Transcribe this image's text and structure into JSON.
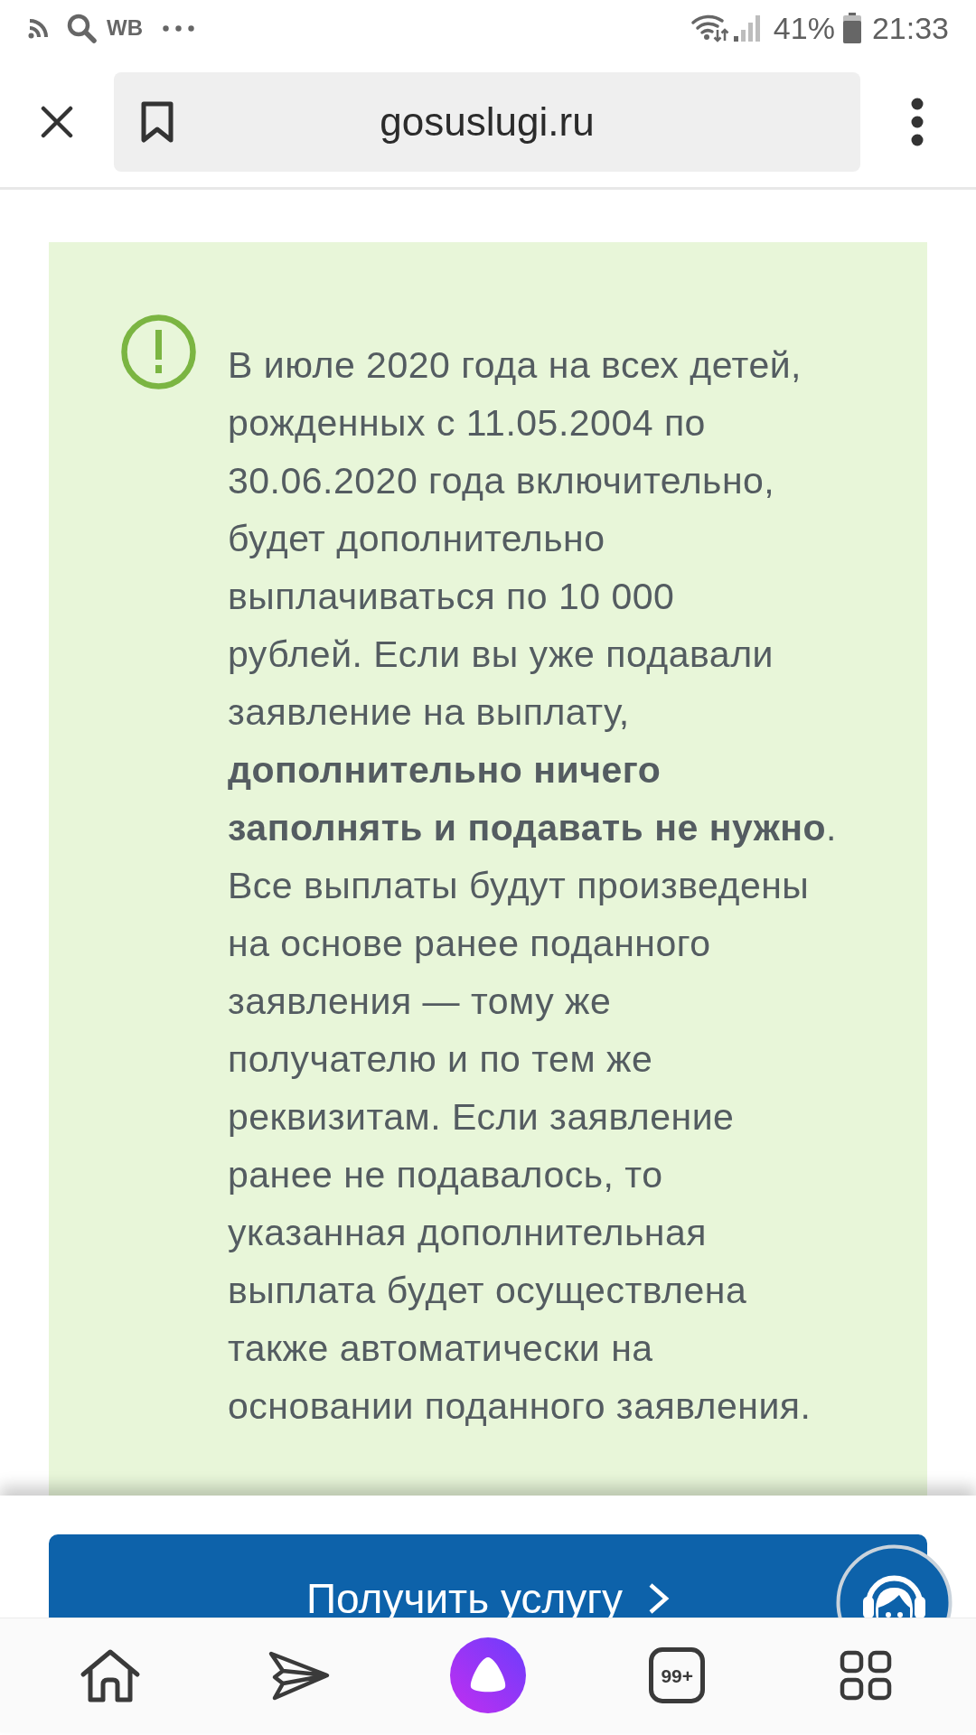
{
  "status_bar": {
    "notification_label": "WB",
    "battery_percent": "41%",
    "time": "21:33"
  },
  "browser_toolbar": {
    "url": "gosuslugi.ru"
  },
  "notice": {
    "lines": [
      "В июле 2020 года на всех детей,",
      "рожденных с 11.05.2004 по",
      "30.06.2020 года включительно,",
      "будет дополнительно",
      "выплачиваться по 10 000",
      "рублей. Если вы уже подавали",
      "заявление на выплату,",
      "**дополнительно ничего**",
      "**заполнять и подавать не нужно**.",
      "Все выплаты будут произведены",
      "на основе ранее поданного",
      "заявления — тому же",
      "получателю и по тем же",
      "реквизитам. Если заявление",
      "ранее не подавалось, то",
      "указанная дополнительная",
      "выплата будет осуществлена",
      "также автоматически на",
      "основании поданного заявления."
    ]
  },
  "action_button": {
    "label": "Получить услугу"
  },
  "bottom_nav": {
    "tabs_count": "99+"
  }
}
